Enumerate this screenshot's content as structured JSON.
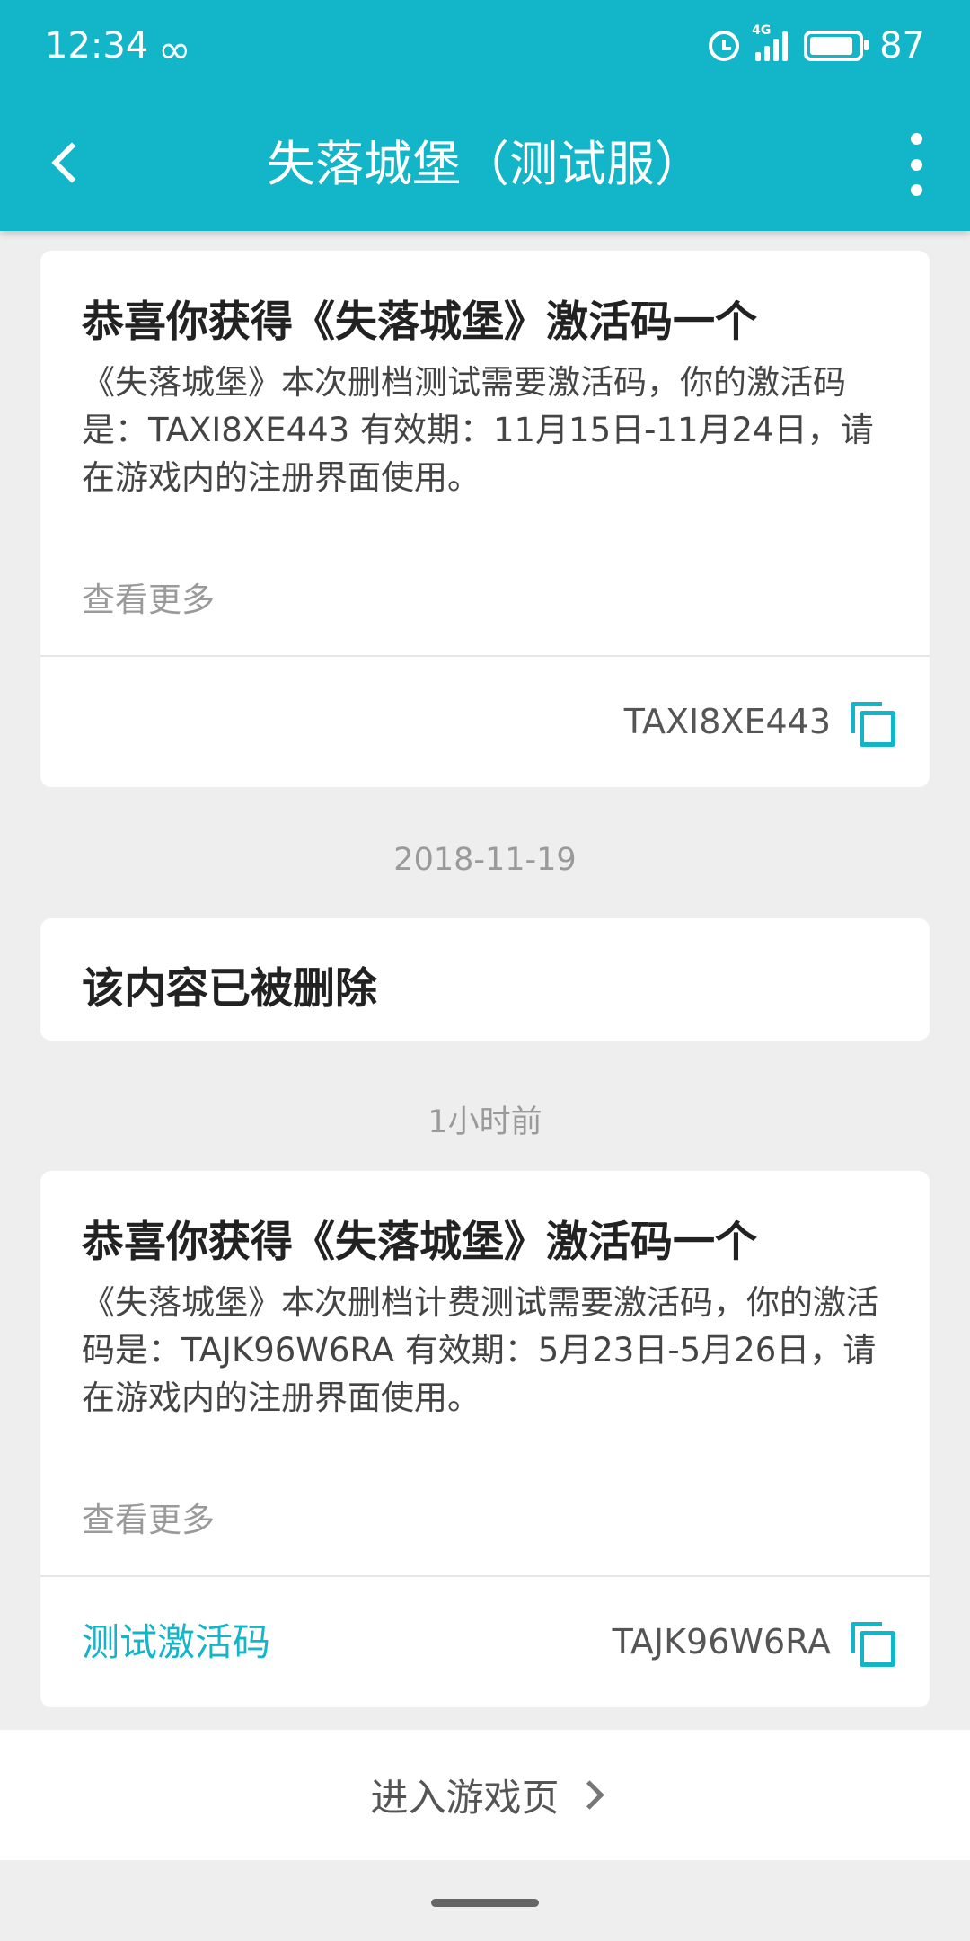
{
  "status_bar": {
    "time": "12:34",
    "network_type": "4G",
    "battery": "87"
  },
  "header": {
    "title": "失落城堡（测试服）"
  },
  "messages": [
    {
      "title": "恭喜你获得《失落城堡》激活码一个",
      "body": "《失落城堡》本次删档测试需要激活码，你的激活码是：TAXI8XE443 有效期：11月15日-11月24日，请在游戏内的注册界面使用。",
      "more_label": "查看更多",
      "code": "TAXI8XE443"
    },
    {
      "date": "2018-11-19",
      "title": "该内容已被删除"
    },
    {
      "date": "1小时前",
      "title": "恭喜你获得《失落城堡》激活码一个",
      "body": "《失落城堡》本次删档计费测试需要激活码，你的激活码是：TAJK96W6RA 有效期：5月23日-5月26日，请在游戏内的注册界面使用。",
      "more_label": "查看更多",
      "tag": "测试激活码",
      "code": "TAJK96W6RA"
    }
  ],
  "bottom": {
    "enter_label": "进入游戏页"
  },
  "colors": {
    "accent": "#13b5c8",
    "background": "#eeeeee"
  }
}
